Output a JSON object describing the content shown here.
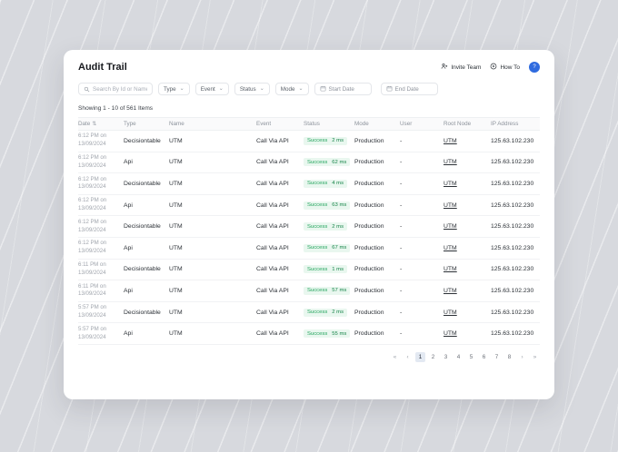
{
  "colors": {
    "accent_blue": "#2f6bdf",
    "success_green": "#22a45c",
    "success_bg": "#e9f7ef"
  },
  "icons": {
    "sort": "⇅",
    "chevron_down": "⌄"
  },
  "page": {
    "title": "Audit Trail"
  },
  "header": {
    "invite_team_label": "Invite Team",
    "how_to_label": "How To",
    "avatar_label": "?"
  },
  "filters": {
    "search_placeholder": "Search By Id or Name",
    "dropdowns": [
      "Type",
      "Event",
      "Status",
      "Mode"
    ],
    "start_date_label": "Start Date",
    "end_date_label": "End Date"
  },
  "summary": "Showing 1 - 10 of 561 Items",
  "table": {
    "columns": [
      "Date",
      "Type",
      "Name",
      "Event",
      "Status",
      "Mode",
      "User",
      "Root Node",
      "IP Address"
    ],
    "rows": [
      {
        "time": "6:12 PM on",
        "date": "13/09/2024",
        "type": "Decisiontable",
        "name": "UTM",
        "event": "Call Via API",
        "status": "Success",
        "latency": "2 ms",
        "mode": "Production",
        "user": "-",
        "root_node": "UTM",
        "ip": "125.63.102.230"
      },
      {
        "time": "6:12 PM on",
        "date": "13/09/2024",
        "type": "Api",
        "name": "UTM",
        "event": "Call Via API",
        "status": "Success",
        "latency": "62 ms",
        "mode": "Production",
        "user": "-",
        "root_node": "UTM",
        "ip": "125.63.102.230"
      },
      {
        "time": "6:12 PM on",
        "date": "13/09/2024",
        "type": "Decisiontable",
        "name": "UTM",
        "event": "Call Via API",
        "status": "Success",
        "latency": "4 ms",
        "mode": "Production",
        "user": "-",
        "root_node": "UTM",
        "ip": "125.63.102.230"
      },
      {
        "time": "6:12 PM on",
        "date": "13/09/2024",
        "type": "Api",
        "name": "UTM",
        "event": "Call Via API",
        "status": "Success",
        "latency": "63 ms",
        "mode": "Production",
        "user": "-",
        "root_node": "UTM",
        "ip": "125.63.102.230"
      },
      {
        "time": "6:12 PM on",
        "date": "13/09/2024",
        "type": "Decisiontable",
        "name": "UTM",
        "event": "Call Via API",
        "status": "Success",
        "latency": "2 ms",
        "mode": "Production",
        "user": "-",
        "root_node": "UTM",
        "ip": "125.63.102.230"
      },
      {
        "time": "6:12 PM on",
        "date": "13/09/2024",
        "type": "Api",
        "name": "UTM",
        "event": "Call Via API",
        "status": "Success",
        "latency": "67 ms",
        "mode": "Production",
        "user": "-",
        "root_node": "UTM",
        "ip": "125.63.102.230"
      },
      {
        "time": "6:11 PM on",
        "date": "13/09/2024",
        "type": "Decisiontable",
        "name": "UTM",
        "event": "Call Via API",
        "status": "Success",
        "latency": "1 ms",
        "mode": "Production",
        "user": "-",
        "root_node": "UTM",
        "ip": "125.63.102.230"
      },
      {
        "time": "6:11 PM on",
        "date": "13/09/2024",
        "type": "Api",
        "name": "UTM",
        "event": "Call Via API",
        "status": "Success",
        "latency": "57 ms",
        "mode": "Production",
        "user": "-",
        "root_node": "UTM",
        "ip": "125.63.102.230"
      },
      {
        "time": "5:57 PM on",
        "date": "13/09/2024",
        "type": "Decisiontable",
        "name": "UTM",
        "event": "Call Via API",
        "status": "Success",
        "latency": "2 ms",
        "mode": "Production",
        "user": "-",
        "root_node": "UTM",
        "ip": "125.63.102.230"
      },
      {
        "time": "5:57 PM on",
        "date": "13/09/2024",
        "type": "Api",
        "name": "UTM",
        "event": "Call Via API",
        "status": "Success",
        "latency": "55 ms",
        "mode": "Production",
        "user": "-",
        "root_node": "UTM",
        "ip": "125.63.102.230"
      }
    ]
  },
  "pagination": {
    "first_label": "«",
    "prev_label": "‹",
    "pages": [
      "1",
      "2",
      "3",
      "4",
      "5",
      "6",
      "7",
      "8"
    ],
    "active_page": "1",
    "next_label": "›",
    "last_label": "»"
  }
}
